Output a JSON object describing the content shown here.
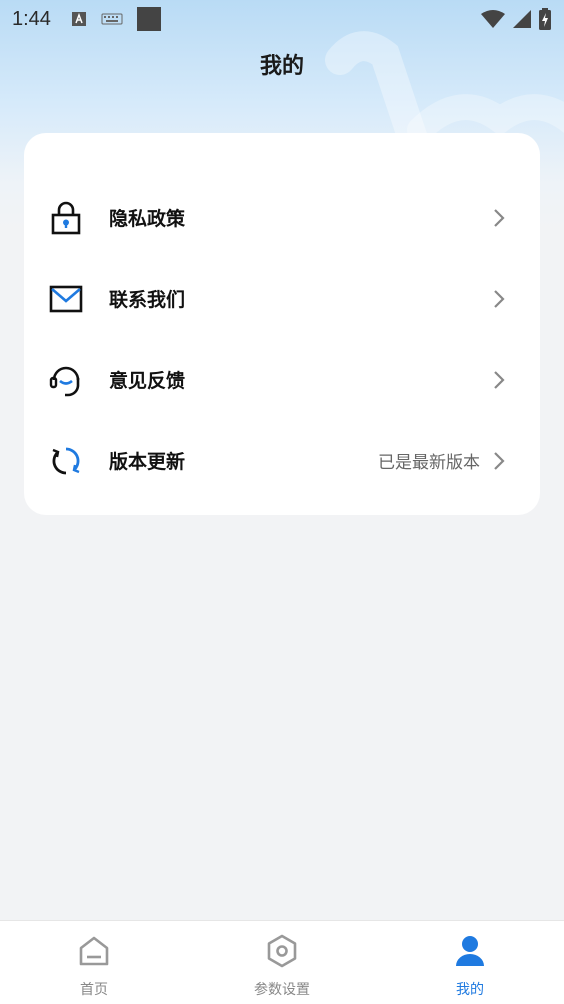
{
  "status_bar": {
    "time": "1:44",
    "icons": [
      "keyboard-a-icon",
      "keyboard-icon",
      "square-icon",
      "wifi-icon",
      "signal-icon",
      "battery-icon"
    ]
  },
  "header": {
    "title": "我的"
  },
  "menu": [
    {
      "label": "隐私政策",
      "icon": "lock-icon",
      "value": ""
    },
    {
      "label": "联系我们",
      "icon": "mail-icon",
      "value": ""
    },
    {
      "label": "意见反馈",
      "icon": "headset-icon",
      "value": ""
    },
    {
      "label": "版本更新",
      "icon": "refresh-icon",
      "value": "已是最新版本"
    }
  ],
  "tabbar": {
    "items": [
      {
        "label": "首页",
        "icon": "home-icon",
        "active": false
      },
      {
        "label": "参数设置",
        "icon": "settings-icon",
        "active": false
      },
      {
        "label": "我的",
        "icon": "user-icon",
        "active": true
      }
    ]
  },
  "colors": {
    "accent": "#1f7ae0",
    "background": "#f2f3f5",
    "header_gradient_top": "#b9dbf5"
  }
}
